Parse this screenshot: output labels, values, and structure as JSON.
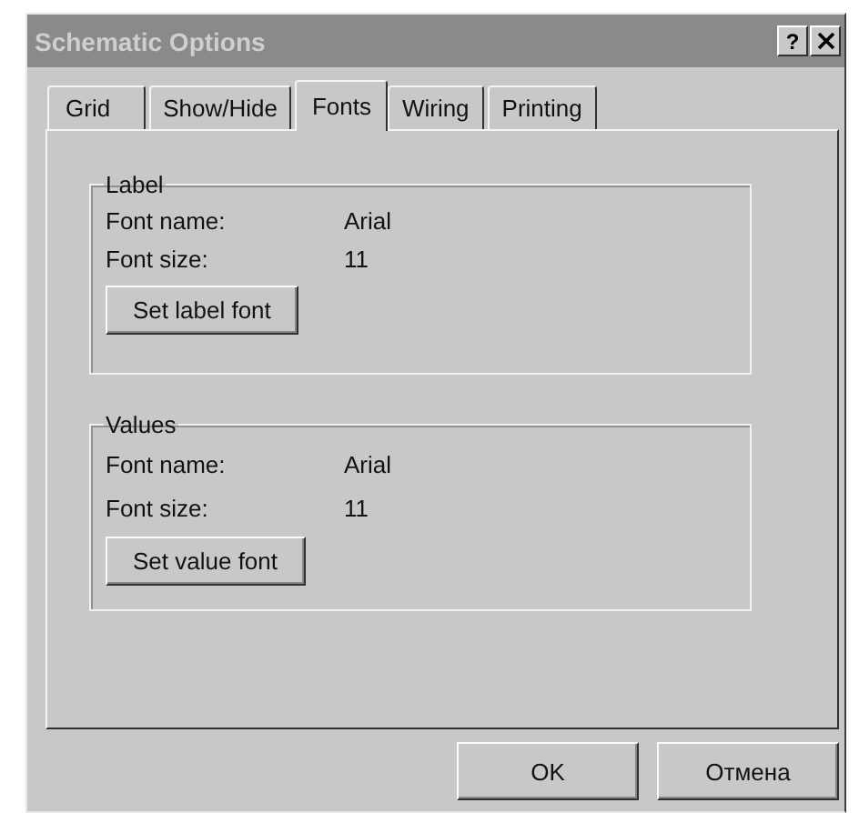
{
  "window": {
    "title": "Schematic Options",
    "help_button": "?"
  },
  "tabs": [
    {
      "label": "Grid",
      "selected": false
    },
    {
      "label": "Show/Hide",
      "selected": false
    },
    {
      "label": "Fonts",
      "selected": true
    },
    {
      "label": "Wiring",
      "selected": false
    },
    {
      "label": "Printing",
      "selected": false
    }
  ],
  "groups": [
    {
      "title": "Label",
      "rows": [
        {
          "label": "Font name:",
          "value": "Arial"
        },
        {
          "label": "Font size:",
          "value": "11"
        }
      ],
      "button": "Set label font"
    },
    {
      "title": "Values",
      "rows": [
        {
          "label": "Font name:",
          "value": "Arial"
        },
        {
          "label": "Font size:",
          "value": "11"
        }
      ],
      "button": "Set value font"
    }
  ],
  "buttons": [
    "OK",
    "Отмена"
  ]
}
